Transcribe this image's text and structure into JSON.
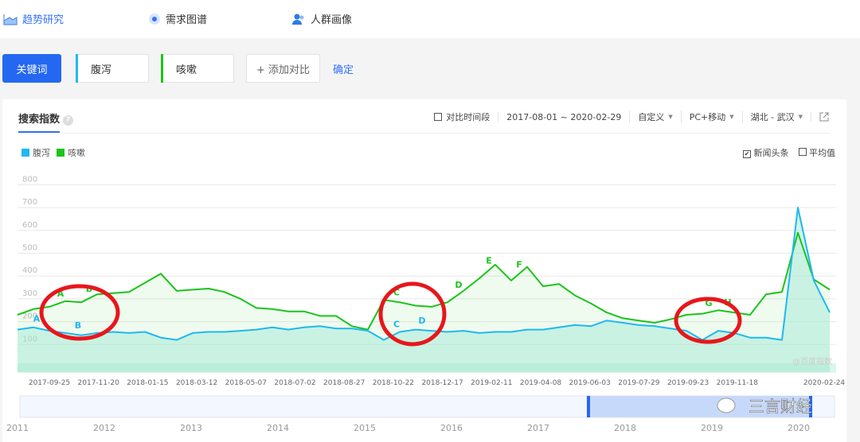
{
  "nav": {
    "items": [
      {
        "label": "趋势研究",
        "icon": "chart-area-icon"
      },
      {
        "label": "需求图谱",
        "icon": "radar-dot-icon"
      },
      {
        "label": "人群画像",
        "icon": "users-icon"
      }
    ]
  },
  "keywords": {
    "button": "关键词",
    "items": [
      {
        "label": "腹泻",
        "color": "#1fb8f1"
      },
      {
        "label": "咳嗽",
        "color": "#1bc41b"
      }
    ],
    "add": "+ 添加对比",
    "confirm": "确定"
  },
  "panel": {
    "title": "搜索指数",
    "help": "?",
    "compare": "对比时间段",
    "date_range": "2017-08-01 ~ 2020-02-29",
    "custom": "自定义",
    "device": "PC+移动",
    "region": "湖北 - 武汉",
    "news": "新闻头条",
    "news_checked": true,
    "average": "平均值",
    "average_checked": false,
    "watermark": "@百度指数",
    "logo_text": "三言财经"
  },
  "chart_data": {
    "type": "area",
    "title": "搜索指数",
    "ylim": [
      0,
      800
    ],
    "yticks": [
      "100",
      "200",
      "300",
      "400",
      "500",
      "600",
      "700",
      "800"
    ],
    "xticks": [
      "2017-09-25",
      "2017-11-20",
      "2018-01-15",
      "2018-03-12",
      "2018-05-07",
      "2018-07-02",
      "2018-08-27",
      "2018-10-22",
      "2018-12-17",
      "2019-02-11",
      "2019-04-08",
      "2019-06-03",
      "2019-07-29",
      "2019-09-23",
      "2019-11-18",
      "2020-02-24"
    ],
    "x_range": [
      "2017-08-01",
      "2020-02-29"
    ],
    "legend": "top-left",
    "series": [
      {
        "name": "腹泻",
        "color": "#1fb8f1",
        "values": [
          165,
          175,
          160,
          150,
          140,
          150,
          155,
          150,
          155,
          130,
          120,
          150,
          155,
          155,
          160,
          165,
          175,
          165,
          175,
          180,
          170,
          170,
          160,
          120,
          155,
          165,
          160,
          155,
          160,
          150,
          155,
          155,
          165,
          165,
          175,
          185,
          180,
          205,
          195,
          185,
          180,
          170,
          160,
          120,
          160,
          150,
          130,
          130,
          120,
          700,
          380,
          240
        ]
      },
      {
        "name": "咳嗽",
        "color": "#1bc41b",
        "values": [
          230,
          255,
          265,
          290,
          285,
          320,
          325,
          330,
          370,
          410,
          335,
          340,
          345,
          330,
          300,
          260,
          255,
          245,
          245,
          225,
          225,
          180,
          165,
          295,
          285,
          270,
          265,
          285,
          335,
          390,
          450,
          380,
          440,
          355,
          365,
          315,
          280,
          240,
          215,
          205,
          195,
          210,
          230,
          235,
          250,
          240,
          230,
          320,
          330,
          590,
          385,
          340
        ]
      }
    ],
    "annotations": [
      {
        "label": "A",
        "series": 0,
        "index": 1.2
      },
      {
        "label": "B",
        "series": 0,
        "index": 3.8
      },
      {
        "label": "A",
        "series": 1,
        "index": 2.7
      },
      {
        "label": "B",
        "series": 1,
        "index": 4.5
      },
      {
        "label": "C",
        "series": 1,
        "index": 23.8
      },
      {
        "label": "C",
        "series": 0,
        "index": 23.8
      },
      {
        "label": "D",
        "series": 0,
        "index": 25.4
      },
      {
        "label": "D",
        "series": 1,
        "index": 27.7
      },
      {
        "label": "E",
        "series": 1,
        "index": 29.6
      },
      {
        "label": "F",
        "series": 1,
        "index": 31.5
      },
      {
        "label": "G",
        "series": 1,
        "index": 43.4
      },
      {
        "label": "H",
        "series": 1,
        "index": 44.6
      }
    ],
    "navigator": {
      "years": [
        "2011",
        "2012",
        "2013",
        "2014",
        "2015",
        "2016",
        "2017",
        "2018",
        "2019",
        "2020"
      ],
      "selection": [
        "2017-08-01",
        "2020-02-29"
      ]
    }
  }
}
